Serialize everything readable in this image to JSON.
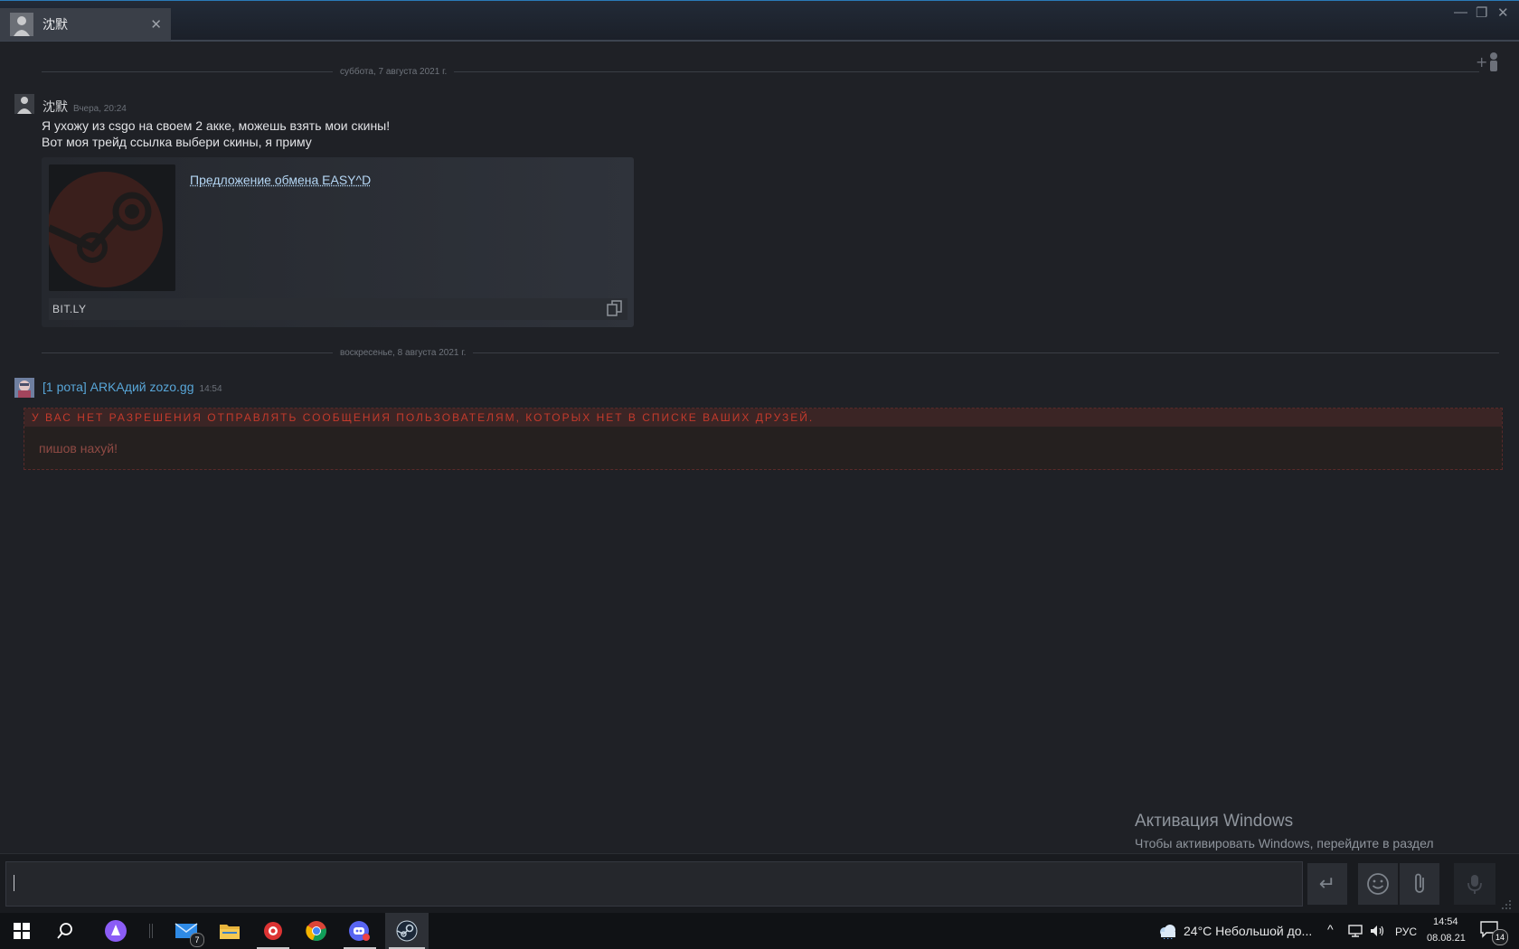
{
  "titlebar": {
    "tab_name": "沈默",
    "close_glyph": "✕",
    "minimize_glyph": "—",
    "restore_glyph": "❐",
    "window_close_glyph": "✕"
  },
  "chat": {
    "date1": "суббота, 7 августа 2021 г.",
    "date2": "воскресенье, 8 августа 2021 г.",
    "msg1": {
      "sender": "沈默",
      "time": "Вчера, 20:24",
      "line1": "Я ухожу из csgo на своем 2 акке, можешь взять мои скины!",
      "line2": "Вот моя трейд ссылка выбери скины, я приму"
    },
    "embed": {
      "title": "Предложение обмена EASY^D",
      "domain": "BIT.LY"
    },
    "msg2": {
      "sender": "[1 рота] ARKАдий zozo.gg",
      "time": "14:54"
    },
    "error": {
      "heading": "У ВАС НЕТ РАЗРЕШЕНИЯ ОТПРАВЛЯТЬ СООБЩЕНИЯ ПОЛЬЗОВАТЕЛЯМ, КОТОРЫХ НЕТ В СПИСКЕ ВАШИХ ДРУЗЕЙ.",
      "text": "пишов нахуй!"
    }
  },
  "watermark": {
    "title": "Активация Windows",
    "text": "Чтобы активировать Windows, перейдите в раздел \"Параметры\"."
  },
  "inputbar": {
    "value": "",
    "send_glyph": "↵"
  },
  "taskbar": {
    "mail_badge": "7",
    "weather": "24°C  Небольшой до...",
    "lang": "РУС",
    "time": "14:54",
    "date": "08.08.21",
    "notif_count": "14"
  },
  "colors": {
    "accent_blue": "#2a7bb8",
    "error_red": "#c43a2c",
    "link": "#b5d7f5",
    "sender2": "#58a6d8"
  }
}
